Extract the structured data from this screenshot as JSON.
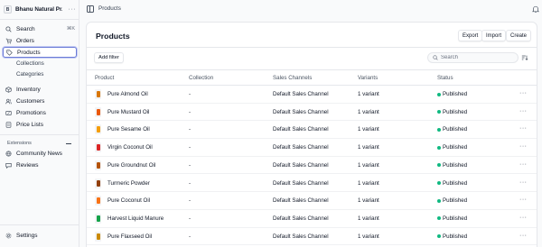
{
  "store": {
    "initial": "B",
    "name": "Bhanu Natural Pr...",
    "more": "···"
  },
  "nav": {
    "search": "Search",
    "search_shortcut": "⌘K",
    "orders": "Orders",
    "products": "Products",
    "collections": "Collections",
    "categories": "Categories",
    "inventory": "Inventory",
    "customers": "Customers",
    "promotions": "Promotions",
    "price_lists": "Price Lists",
    "extensions_title": "Extensions",
    "community_news": "Community News",
    "reviews": "Reviews",
    "settings": "Settings"
  },
  "breadcrumb": "Products",
  "page": {
    "title": "Products",
    "export": "Export",
    "import": "Import",
    "create": "Create",
    "add_filter": "Add filter",
    "search_placeholder": "Search"
  },
  "table": {
    "headers": {
      "product": "Product",
      "collection": "Collection",
      "sales_channels": "Sales Channels",
      "variants": "Variants",
      "status": "Status"
    },
    "rows": [
      {
        "product": "Pure Almond Oil",
        "collection": "-",
        "channel": "Default Sales Channel",
        "variants": "1 variant",
        "status": "Published",
        "thumb_color": "#d97706"
      },
      {
        "product": "Pure Mustard Oil",
        "collection": "-",
        "channel": "Default Sales Channel",
        "variants": "1 variant",
        "status": "Published",
        "thumb_color": "#ea580c"
      },
      {
        "product": "Pure Sesame Oil",
        "collection": "-",
        "channel": "Default Sales Channel",
        "variants": "1 variant",
        "status": "Published",
        "thumb_color": "#f59e0b"
      },
      {
        "product": "Virgin Coconut Oil",
        "collection": "-",
        "channel": "Default Sales Channel",
        "variants": "1 variant",
        "status": "Published",
        "thumb_color": "#dc2626"
      },
      {
        "product": "Pure Groundnut Oil",
        "collection": "-",
        "channel": "Default Sales Channel",
        "variants": "1 variant",
        "status": "Published",
        "thumb_color": "#b45309"
      },
      {
        "product": "Turmeric Powder",
        "collection": "-",
        "channel": "Default Sales Channel",
        "variants": "1 variant",
        "status": "Published",
        "thumb_color": "#92400e"
      },
      {
        "product": "Pure Coconut Oil",
        "collection": "-",
        "channel": "Default Sales Channel",
        "variants": "1 variant",
        "status": "Published",
        "thumb_color": "#f97316"
      },
      {
        "product": "Harvest Liquid Manure",
        "collection": "-",
        "channel": "Default Sales Channel",
        "variants": "1 variant",
        "status": "Published",
        "thumb_color": "#16a34a"
      },
      {
        "product": "Pure Flaxseed Oil",
        "collection": "-",
        "channel": "Default Sales Channel",
        "variants": "1 variant",
        "status": "Published",
        "thumb_color": "#ca8a04"
      }
    ],
    "row_more": "···"
  },
  "colors": {
    "accent": "#6b7bd6",
    "published": "#10b981"
  },
  "icons": [
    "search-icon",
    "orders-icon",
    "tag-icon",
    "inventory-icon",
    "customers-icon",
    "promotions-icon",
    "price-list-icon",
    "news-icon",
    "reviews-icon",
    "settings-icon",
    "sidebar-toggle-icon",
    "notification-icon",
    "sort-icon"
  ]
}
